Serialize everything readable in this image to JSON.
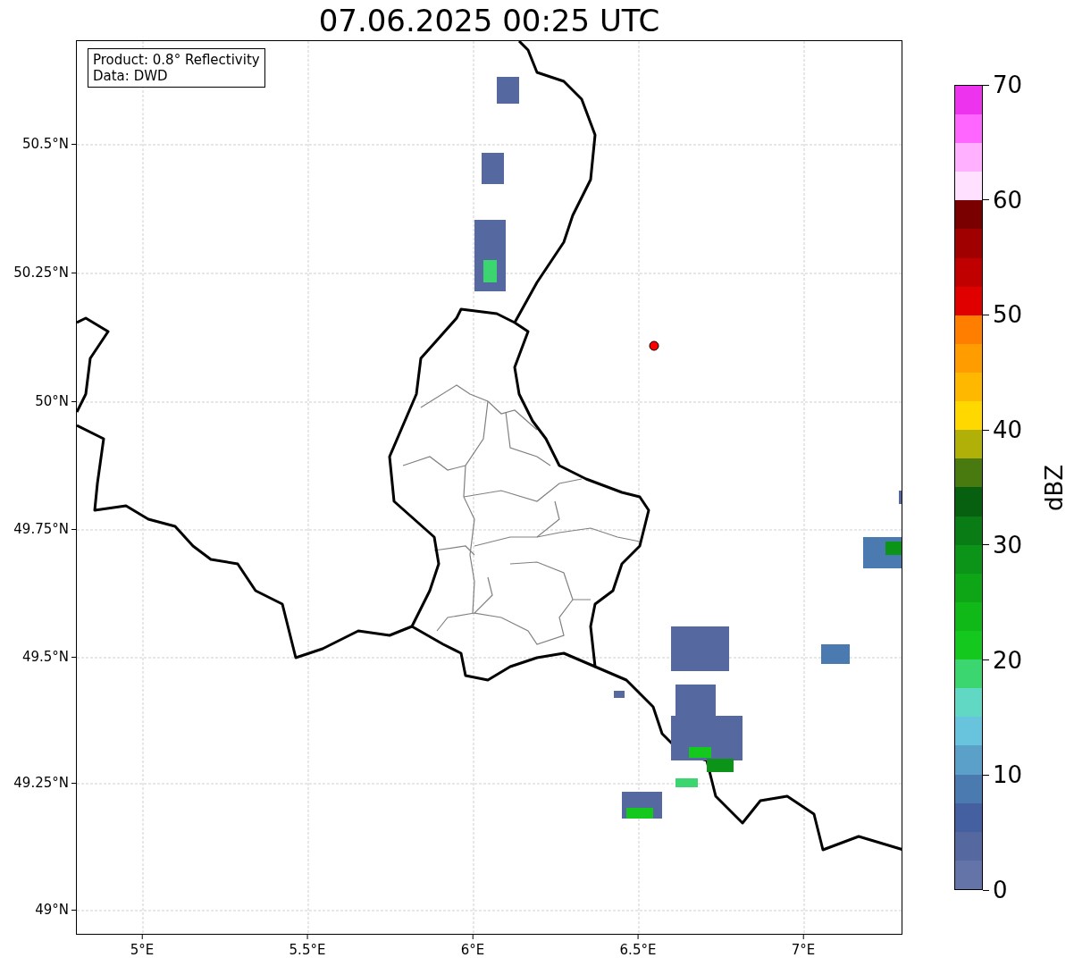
{
  "title": "07.06.2025 00:25 UTC",
  "info_box": {
    "product": "Product: 0.8° Reflectivity",
    "data": "Data: DWD"
  },
  "map": {
    "xticks": [
      "5°E",
      "5.5°E",
      "6°E",
      "6.5°E",
      "7°E"
    ],
    "yticks": [
      "50.5°N",
      "50.25°N",
      "50°N",
      "49.75°N",
      "49.5°N",
      "49.25°N",
      "49°N"
    ]
  },
  "colorbar": {
    "label": "dBZ",
    "ticks": [
      "70",
      "60",
      "50",
      "40",
      "30",
      "20",
      "10",
      "0"
    ],
    "bands": [
      {
        "color": "#6574a8"
      },
      {
        "color": "#5568a0"
      },
      {
        "color": "#4460a0"
      },
      {
        "color": "#4a7ab0"
      },
      {
        "color": "#5aa0c8"
      },
      {
        "color": "#68c4dc"
      },
      {
        "color": "#60d8c4"
      },
      {
        "color": "#3cd670"
      },
      {
        "color": "#14c81e"
      },
      {
        "color": "#10b818"
      },
      {
        "color": "#0ea616"
      },
      {
        "color": "#0c9418"
      },
      {
        "color": "#0a7c16"
      },
      {
        "color": "#076010"
      },
      {
        "color": "#487a10"
      },
      {
        "color": "#b0b008"
      },
      {
        "color": "#ffd800"
      },
      {
        "color": "#ffb800"
      },
      {
        "color": "#ff9c00"
      },
      {
        "color": "#ff7e00"
      },
      {
        "color": "#e00000"
      },
      {
        "color": "#c00000"
      },
      {
        "color": "#a00000"
      },
      {
        "color": "#7a0000"
      },
      {
        "color": "#ffe0ff"
      },
      {
        "color": "#ffb0ff"
      },
      {
        "color": "#ff66ff"
      },
      {
        "color": "#ee33ee"
      }
    ]
  }
}
